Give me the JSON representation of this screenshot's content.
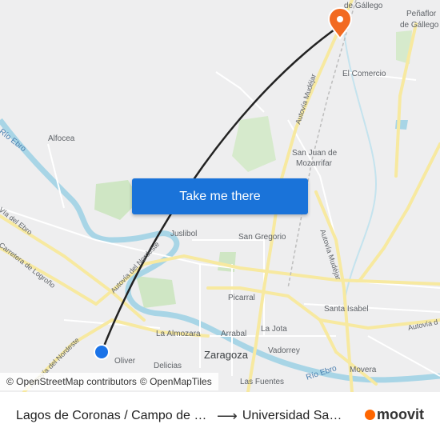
{
  "map": {
    "places": {
      "gallego_top": "de Gállego",
      "penaflor": "Peñaflor",
      "penaflor_sub": "de Gállego",
      "alfocea": "Alfocea",
      "el_comercio": "El Comercio",
      "san_juan": "San Juan de",
      "mozarrifar": "Mozarrifar",
      "juslibol": "Juslibol",
      "san_gregorio": "San Gregorio",
      "picarral": "Picarral",
      "santa_isabel": "Santa Isabel",
      "la_almozara": "La Almozara",
      "arrabal": "Arrabal",
      "la_jota": "La Jota",
      "zaragoza": "Zaragoza",
      "vadorrey": "Vadorrey",
      "oliver": "Oliver",
      "delicias": "Delicias",
      "las_fuentes": "Las Fuentes",
      "movera": "Movera"
    },
    "roads": {
      "mudejar_1": "Autovía Mudéjar",
      "mudejar_2": "Autovía Mudéjar",
      "nordeste_1": "Autovía del Nordeste",
      "nordeste_2": "Autovía del Nordeste",
      "via_ebro": "Vía del Ebro",
      "logrono": "Carretera de Logroño",
      "autovia_right": "Autovía d"
    },
    "rivers": {
      "ebro_left": "Río Ebro",
      "ebro_right": "Río Ebro"
    },
    "cta_label": "Take me there",
    "attribution": {
      "osm": "© OpenStreetMap contributors",
      "omt": "© OpenMapTiles"
    },
    "colors": {
      "background": "#eeeeef",
      "motorway": "#f7e9a0",
      "water": "#a8d5e6",
      "park": "#cfe6c4",
      "route_line": "#222222",
      "origin_marker": "#1a73e8",
      "destination_marker": "#f26a21",
      "button": "#1a73d9"
    },
    "markers": {
      "origin_icon": "origin-dot-icon",
      "destination_icon": "destination-pin-icon"
    }
  },
  "footer": {
    "from": "Lagos de Coronas / Campo de Golf",
    "to": "Universidad San Jorge",
    "arrow_icon": "arrow-right-icon",
    "brand": "moovit"
  }
}
